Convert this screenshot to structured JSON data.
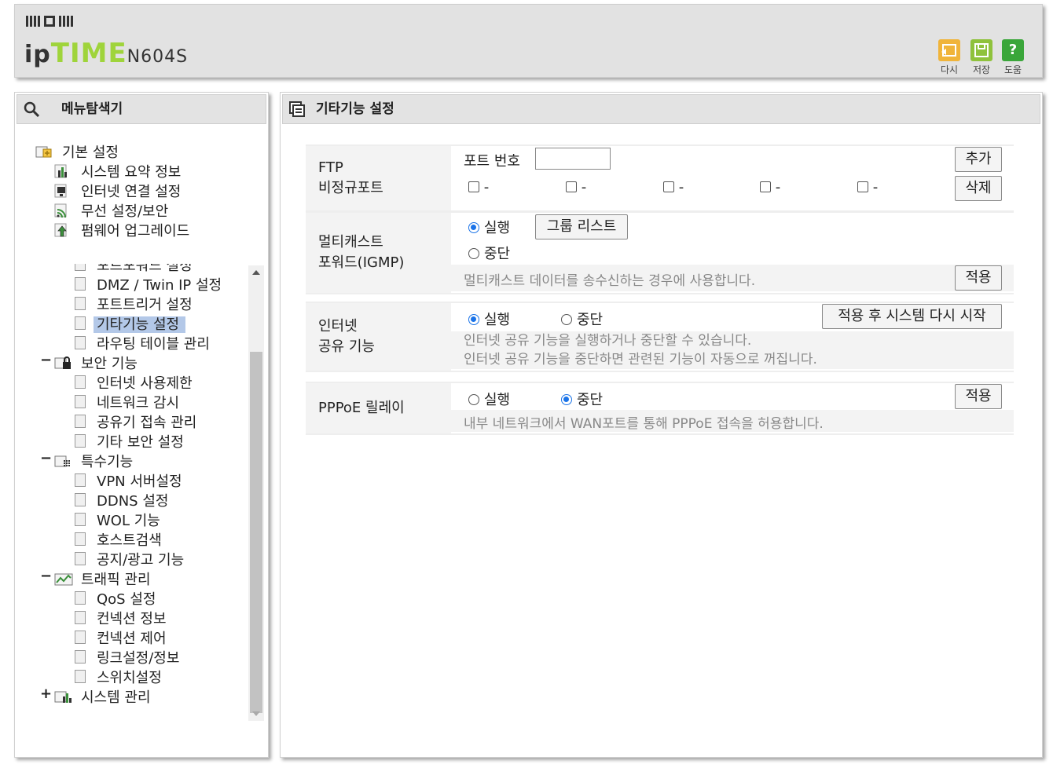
{
  "header": {
    "brand_prefix": "ip",
    "brand_mark": "TIME",
    "model": "N604S",
    "buttons": [
      {
        "label": "다시",
        "icon": "undo-icon",
        "color": "#f0b43a"
      },
      {
        "label": "저장",
        "icon": "save-icon",
        "color": "#8fc23c"
      },
      {
        "label": "도움",
        "icon": "help-icon",
        "color": "#3aa63a"
      }
    ],
    "help_glyph": "?"
  },
  "sidebar": {
    "title": "메뉴탐색기",
    "basic": {
      "label": "기본 설정",
      "items": [
        "시스템 요약 정보",
        "인터넷 연결 설정",
        "무선 설정/보안",
        "펌웨어 업그레이드"
      ]
    },
    "scrolled_items": [
      "포트포워드 설정",
      "DMZ / Twin IP 설정",
      "포트트리거 설정",
      "기타기능 설정",
      "라우팅 테이블 관리"
    ],
    "security": {
      "label": "보안 기능",
      "items": [
        "인터넷 사용제한",
        "네트워크 감시",
        "공유기 접속 관리",
        "기타 보안 설정"
      ]
    },
    "special": {
      "label": "특수기능",
      "items": [
        "VPN 서버설정",
        "DDNS 설정",
        "WOL 기능",
        "호스트검색",
        "공지/광고 기능"
      ]
    },
    "traffic": {
      "label": "트래픽 관리",
      "items": [
        "QoS 설정",
        "컨넥션 정보",
        "컨넥션 제어",
        "링크설정/정보",
        "스위치설정"
      ]
    },
    "system": {
      "label": "시스템 관리"
    },
    "toggle_collapse": "−",
    "toggle_expand": "+"
  },
  "main": {
    "title": "기타기능 설정",
    "ftp": {
      "label_line1": "FTP",
      "label_line2": "비정규포트",
      "port_label": "포트 번호",
      "port_value": "",
      "add_button": "추가",
      "delete_button": "삭제",
      "slot_text": "-"
    },
    "igmp": {
      "label_line1": "멀티캐스트",
      "label_line2": "포워드(IGMP)",
      "run": "실행",
      "stop": "중단",
      "group_button": "그룹 리스트",
      "desc": "멀티캐스트 데이터를 송수신하는 경우에 사용합니다.",
      "apply_button": "적용"
    },
    "sharing": {
      "label_line1": "인터넷",
      "label_line2": "공유 기능",
      "run": "실행",
      "stop": "중단",
      "restart_button": "적용 후 시스템 다시 시작",
      "desc1": "인터넷 공유 기능을 실행하거나 중단할 수 있습니다.",
      "desc2": "인터넷 공유 기능을 중단하면 관련된 기능이 자동으로 꺼집니다."
    },
    "pppoe": {
      "label": "PPPoE 릴레이",
      "run": "실행",
      "stop": "중단",
      "apply_button": "적용",
      "desc": "내부 네트워크에서 WAN포트를 통해 PPPoE 접속을 허용합니다."
    }
  }
}
